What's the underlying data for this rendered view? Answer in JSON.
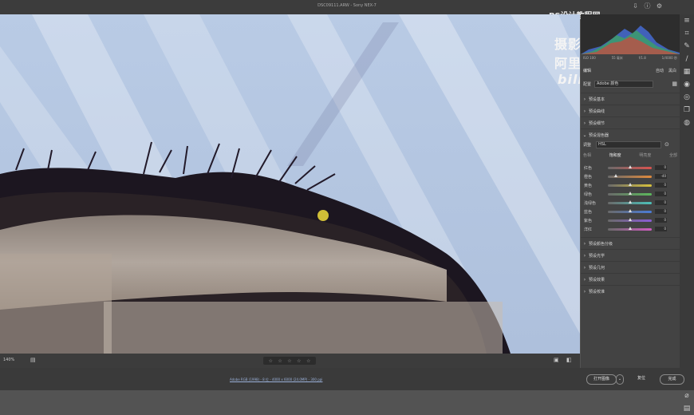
{
  "titlebar": {
    "title": "DSC09111.ARW - Sony NEX-7"
  },
  "watermark": {
    "site": "PS设计教程网",
    "author": "摄影师阿里",
    "brand": "bilibili"
  },
  "top_icons": [
    "download-icon",
    "info-icon",
    "gear-icon"
  ],
  "histogram": {
    "iso": "ISO 100",
    "focal": "55 毫米",
    "aperture": "f/1.8",
    "shutter": "1/4000 秒"
  },
  "panel": {
    "title": "编辑",
    "auto": "自动",
    "bw": "黑白",
    "profile_label": "配置",
    "profile_value": "Adobe 颜色",
    "sections_top": [
      "预设基本",
      "预设曲线",
      "预设细节",
      "预设混色器"
    ],
    "adjust_label": "调整",
    "adjust_value": "HSL",
    "subtabs": [
      "色相",
      "饱和度",
      "明亮度",
      "全部"
    ],
    "active_subtab": 1,
    "sliders": [
      {
        "name": "红色",
        "value": "0",
        "pos": 0.5,
        "color": "#d9534f"
      },
      {
        "name": "橙色",
        "value": "-40",
        "pos": 0.18,
        "color": "#e08a3c"
      },
      {
        "name": "黄色",
        "value": "0",
        "pos": 0.5,
        "color": "#d8c23c"
      },
      {
        "name": "绿色",
        "value": "0",
        "pos": 0.5,
        "color": "#5cb85c"
      },
      {
        "name": "浅绿色",
        "value": "0",
        "pos": 0.5,
        "color": "#4cc0b8"
      },
      {
        "name": "蓝色",
        "value": "0",
        "pos": 0.5,
        "color": "#4a7bd6"
      },
      {
        "name": "紫色",
        "value": "0",
        "pos": 0.5,
        "color": "#8a5cd6"
      },
      {
        "name": "洋红",
        "value": "0",
        "pos": 0.5,
        "color": "#d05cc0"
      }
    ],
    "sections_bottom": [
      "预设颜色分级",
      "预设光学",
      "预设几何",
      "预设效果",
      "预设校准"
    ]
  },
  "bottom": {
    "zoom": "140%",
    "stars": [
      "☆",
      "☆",
      "☆",
      "☆",
      "☆"
    ]
  },
  "footer": {
    "info": "Adobe RGB (1998) - 8 位 - 4000 x 6000 (24.0MP) - 300 ppi",
    "open": "打开图像",
    "reset": "复位",
    "done": "完成"
  }
}
